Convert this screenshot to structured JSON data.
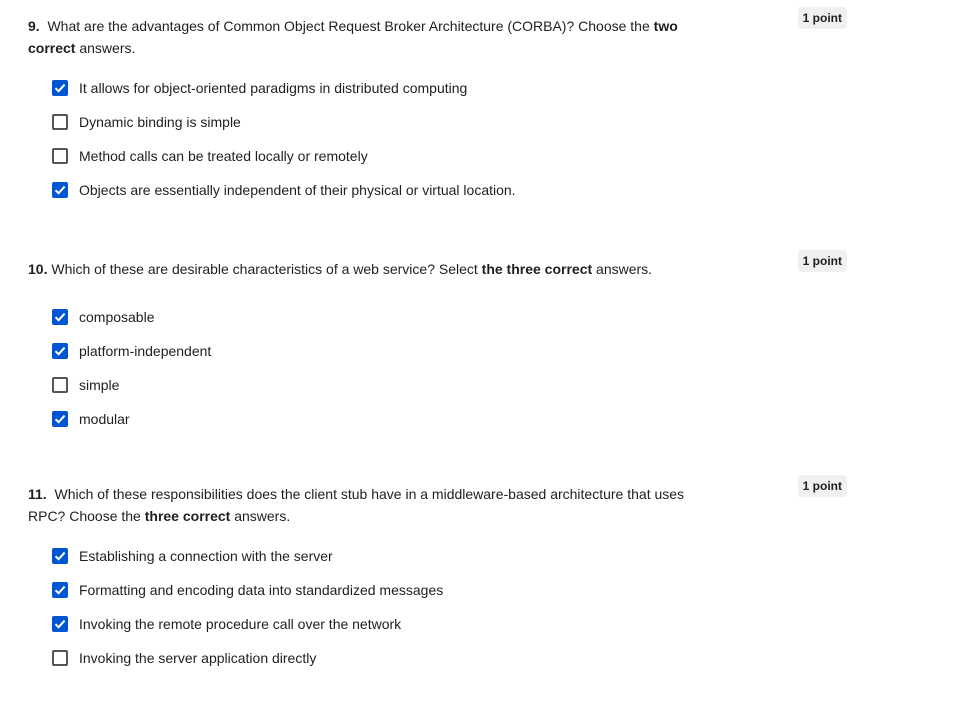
{
  "questions": [
    {
      "number": "9.",
      "text_before": "What are the advantages of Common Object Request Broker Architecture (CORBA)? Choose the ",
      "text_bold": "two correct",
      "text_after": " answers.",
      "points": "1 point",
      "options": [
        {
          "label": "It allows for object-oriented paradigms in distributed computing",
          "checked": true
        },
        {
          "label": "Dynamic binding is simple",
          "checked": false
        },
        {
          "label": "Method calls can be treated locally or remotely",
          "checked": false
        },
        {
          "label": "Objects are essentially independent of their physical or virtual location.",
          "checked": true
        }
      ]
    },
    {
      "number": "10.",
      "text_before": "Which of these are desirable characteristics of a web service? Select ",
      "text_bold": "the three correct",
      "text_after": " answers.",
      "points": "1 point",
      "options": [
        {
          "label": "composable",
          "checked": true
        },
        {
          "label": "platform-independent",
          "checked": true
        },
        {
          "label": "simple",
          "checked": false
        },
        {
          "label": "modular",
          "checked": true
        }
      ]
    },
    {
      "number": "11.",
      "text_before": "Which of these responsibilities does the client stub have in a middleware-based architecture that uses RPC? Choose the ",
      "text_bold": "three correct",
      "text_after": " answers.",
      "points": "1 point",
      "options": [
        {
          "label": "Establishing a connection with the server",
          "checked": true
        },
        {
          "label": "Formatting and encoding data into standardized messages",
          "checked": true
        },
        {
          "label": "Invoking the remote procedure call over the network",
          "checked": true
        },
        {
          "label": "Invoking the server application directly",
          "checked": false
        }
      ]
    }
  ],
  "colors": {
    "checkbox_checked": "#0056d2",
    "points_badge_bg": "#f0f0f0"
  }
}
